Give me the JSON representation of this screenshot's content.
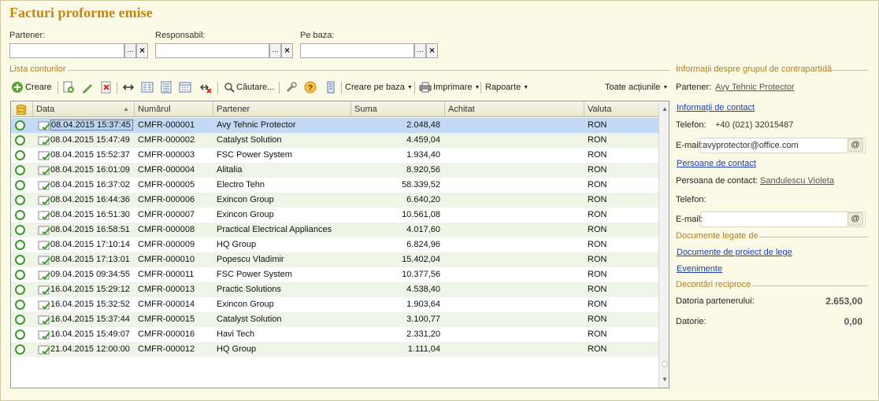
{
  "title": "Facturi proforme emise",
  "filters": {
    "partener_label": "Partener:",
    "responsabil_label": "Responsabil:",
    "pe_baza_label": "Pe baza:",
    "select_glyph": "...",
    "clear_glyph": "×"
  },
  "list_section_title": "Lista conturilor",
  "toolbar": {
    "create_label": "Creare",
    "search_label": "Căutare...",
    "create_based_label": "Creare pe baza",
    "print_label": "Imprimare",
    "reports_label": "Rapoarte",
    "all_actions_label": "Toate acțiunile"
  },
  "table": {
    "columns": [
      "Data",
      "Numărul",
      "Partener",
      "Suma",
      "Achitat",
      "Valuta"
    ],
    "rows": [
      {
        "date": "08.04.2015 15:37:45",
        "number": "CMFR-000001",
        "partner": "Avy Tehnic Protector",
        "sum": "2.048,48",
        "paid": "",
        "currency": "RON"
      },
      {
        "date": "08.04.2015 15:47:49",
        "number": "CMFR-000002",
        "partner": "Catalyst Solution",
        "sum": "4.459,04",
        "paid": "",
        "currency": "RON"
      },
      {
        "date": "08.04.2015 15:52:37",
        "number": "CMFR-000003",
        "partner": "FSC Power System",
        "sum": "1.934,40",
        "paid": "",
        "currency": "RON"
      },
      {
        "date": "08.04.2015 16:01:09",
        "number": "CMFR-000004",
        "partner": "Alitalia",
        "sum": "8.920,56",
        "paid": "",
        "currency": "RON"
      },
      {
        "date": "08.04.2015 16:37:02",
        "number": "CMFR-000005",
        "partner": "Electro Tehn",
        "sum": "58.339,52",
        "paid": "",
        "currency": "RON"
      },
      {
        "date": "08.04.2015 16:44:36",
        "number": "CMFR-000006",
        "partner": "Exincon Group",
        "sum": "6.640,20",
        "paid": "",
        "currency": "RON"
      },
      {
        "date": "08.04.2015 16:51:30",
        "number": "CMFR-000007",
        "partner": "Exincon Group",
        "sum": "10.561,08",
        "paid": "",
        "currency": "RON"
      },
      {
        "date": "08.04.2015 16:58:51",
        "number": "CMFR-000008",
        "partner": "Practical Electrical Appliances",
        "sum": "4.017,60",
        "paid": "",
        "currency": "RON"
      },
      {
        "date": "08.04.2015 17:10:14",
        "number": "CMFR-000009",
        "partner": "HQ Group",
        "sum": "6.824,96",
        "paid": "",
        "currency": "RON"
      },
      {
        "date": "08.04.2015 17:13:01",
        "number": "CMFR-000010",
        "partner": "Popescu Vladimir",
        "sum": "15.402,04",
        "paid": "",
        "currency": "RON"
      },
      {
        "date": "09.04.2015 09:34:55",
        "number": "CMFR-000011",
        "partner": "FSC Power System",
        "sum": "10.377,56",
        "paid": "",
        "currency": "RON"
      },
      {
        "date": "16.04.2015 15:29:12",
        "number": "CMFR-000013",
        "partner": "Practic Solutions",
        "sum": "4.538,40",
        "paid": "",
        "currency": "RON"
      },
      {
        "date": "16.04.2015 15:32:52",
        "number": "CMFR-000014",
        "partner": "Exincon Group",
        "sum": "1.903,64",
        "paid": "",
        "currency": "RON"
      },
      {
        "date": "16.04.2015 15:37:44",
        "number": "CMFR-000015",
        "partner": "Catalyst Solution",
        "sum": "3.100,77",
        "paid": "",
        "currency": "RON"
      },
      {
        "date": "16.04.2015 15:49:07",
        "number": "CMFR-000016",
        "partner": "Havi Tech",
        "sum": "2.331,20",
        "paid": "",
        "currency": "RON"
      },
      {
        "date": "21.04.2015 12:00:00",
        "number": "CMFR-000012",
        "partner": "HQ Group",
        "sum": "1.111,04",
        "paid": "",
        "currency": "RON"
      }
    ]
  },
  "panel": {
    "section_title": "Informații despre grupul de contrapartidă",
    "partner_label": "Partener:",
    "partner_value": "Avy Tehnic Protector",
    "contact_info_link": "Informații de contact",
    "phone_label": "Telefon:",
    "phone_value": "+40 (021) 32015487",
    "email_label": "E-mail:",
    "email_value": "avyprotector@office.com",
    "at_glyph": "@",
    "contacts_link": "Persoane de contact",
    "contact_person_label": "Persoana de contact:",
    "contact_person_value": "Sandulescu Violeta",
    "phone2_label": "Telefon:",
    "email2_label": "E-mail:",
    "linked_docs_title": "Documente legate de",
    "draft_docs_link": "Documente de proiect de lege",
    "events_link": "Evenimente",
    "settlements_title": "Decontări reciproce",
    "partner_debt_label": "Datoria partenerului:",
    "partner_debt_value": "2.653,00",
    "debt_label": "Datorie:",
    "debt_value": "0,00"
  },
  "colors": {
    "title": "#c9860e",
    "section": "#b07d22",
    "background": "#fbfae6",
    "selected_row": "#c4daf4",
    "alt_row": "#eef5e6",
    "link": "#1d3ea8",
    "status_circle": "#3b9a2a"
  },
  "icons": [
    "create-icon",
    "copy-icon",
    "edit-icon",
    "delete-icon",
    "refresh-icon",
    "list-view-icon",
    "tree-view-icon",
    "calendar-icon",
    "clear-filter-icon",
    "search-icon",
    "settings-icon",
    "help-icon",
    "post-icon",
    "print-icon",
    "document-icon",
    "status-circle-icon"
  ]
}
